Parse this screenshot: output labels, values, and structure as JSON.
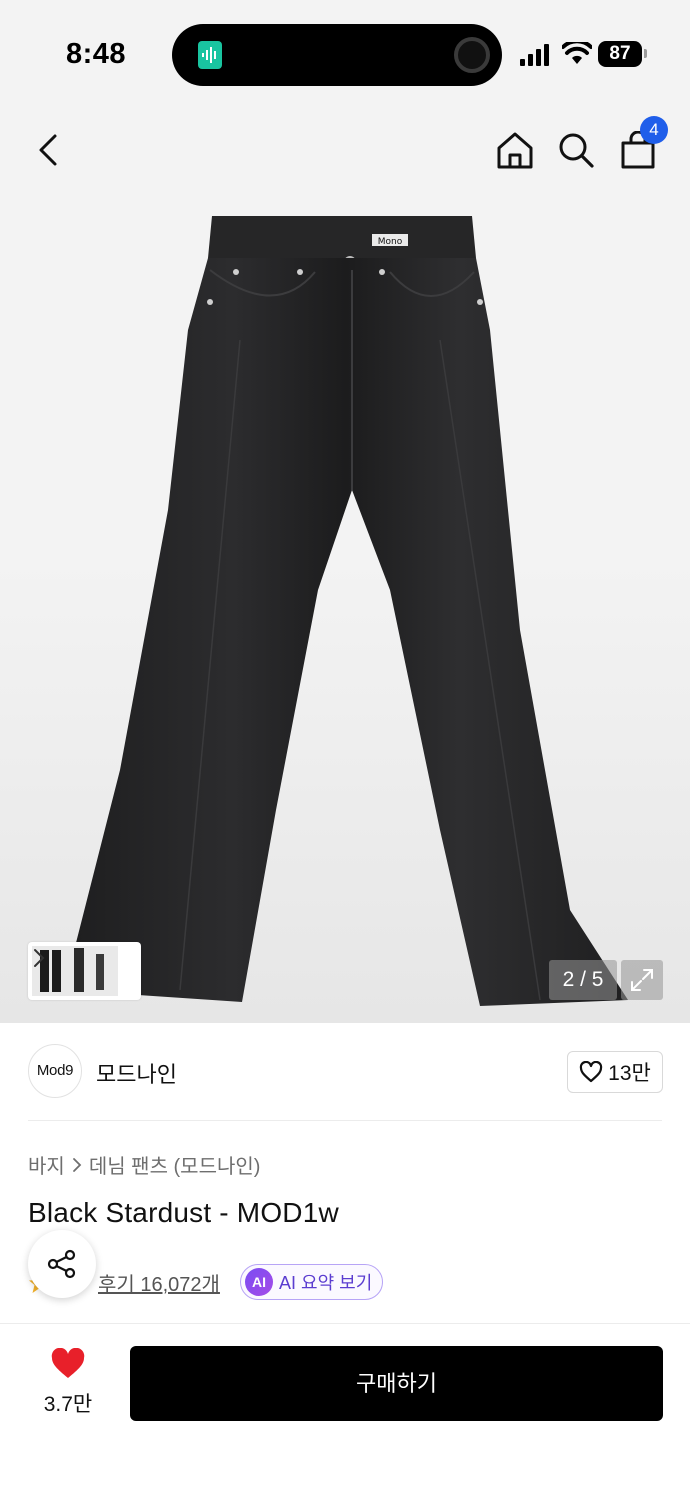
{
  "status_bar": {
    "time": "8:48",
    "battery": "87"
  },
  "topnav": {
    "cart_count": "4"
  },
  "gallery": {
    "counter": "2 / 5"
  },
  "brand": {
    "logo_text": "Mod9",
    "name": "모드나인",
    "like_count": "13만"
  },
  "breadcrumb": {
    "category": "바지",
    "subcategory": "데님 팬츠 (모드나인)"
  },
  "product": {
    "title": "Black Stardust - MOD1w",
    "reviews_text": "후기 16,072개"
  },
  "ai_summary": {
    "badge": "AI",
    "label": "AI 요약 보기"
  },
  "bottom_bar": {
    "favorite_count": "3.7만",
    "buy_label": "구매하기"
  },
  "colors": {
    "accent_blue": "#1f5eea",
    "heart_red": "#e8202a",
    "buy_button": "#000000",
    "ai_purple": "#7a4cf2"
  }
}
